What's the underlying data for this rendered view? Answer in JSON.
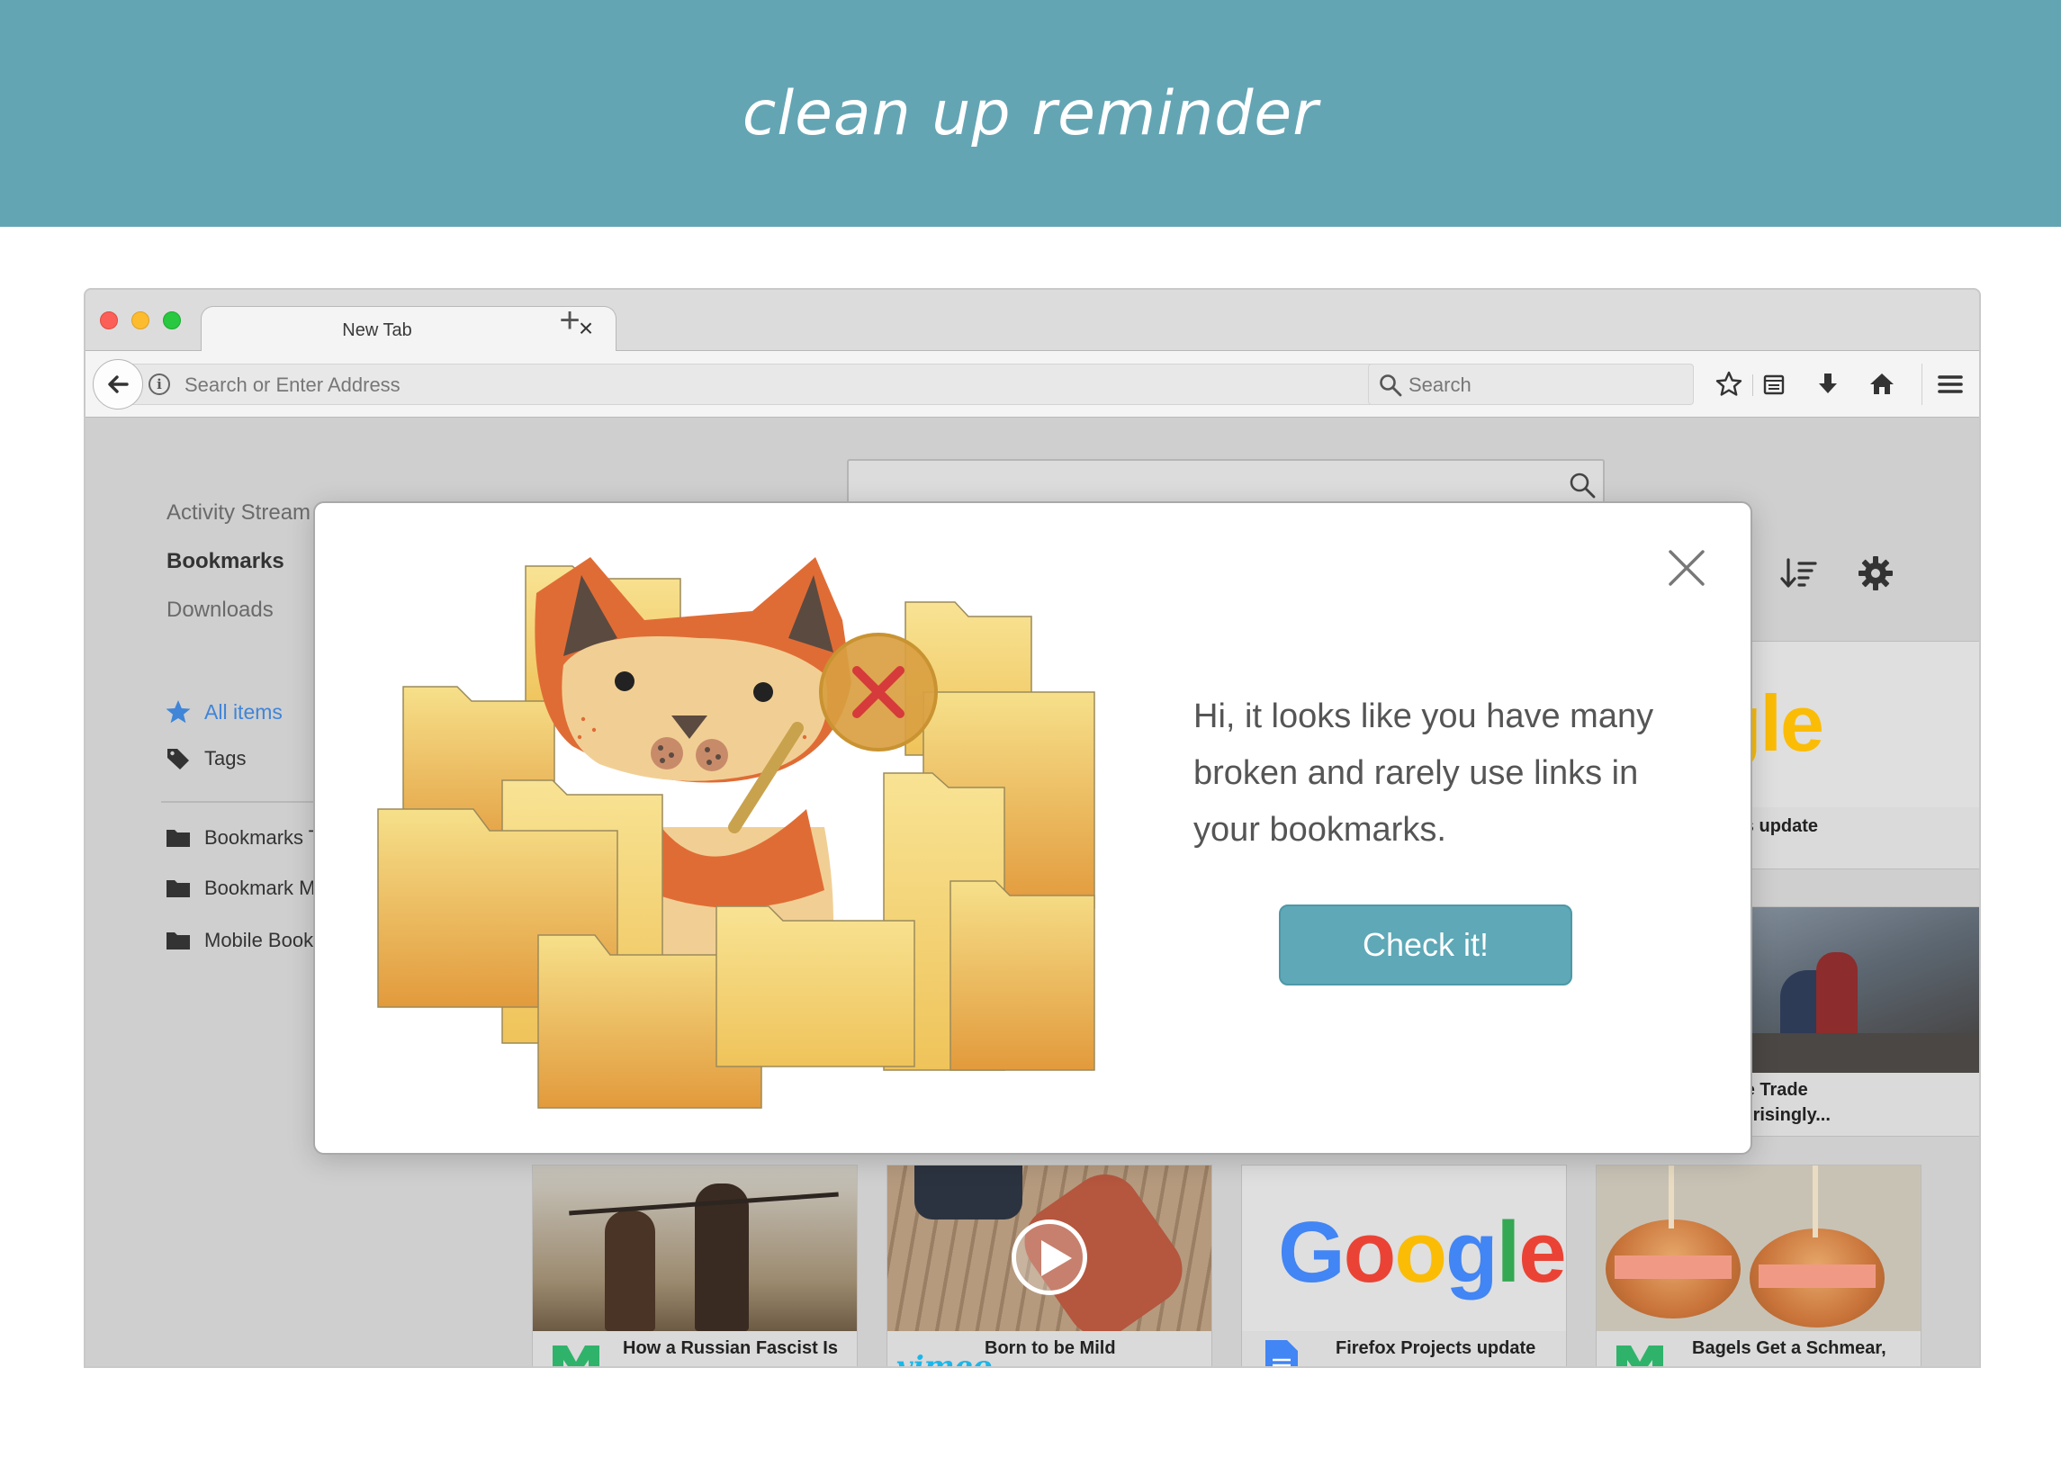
{
  "banner": {
    "title": "clean up reminder"
  },
  "tab": {
    "label": "New Tab",
    "close_glyph": "×",
    "new_tab_glyph": "+"
  },
  "toolbar": {
    "address_placeholder": "Search or Enter Address",
    "search_placeholder": "Search"
  },
  "sidebar": {
    "top_items": [
      "Activity Stream",
      "Bookmarks",
      "Downloads"
    ],
    "items": [
      {
        "label": "All items",
        "icon": "star-icon",
        "active": true
      },
      {
        "label": "Tags",
        "icon": "tag-icon",
        "active": false
      }
    ],
    "folders": [
      {
        "label": "Bookmarks T",
        "icon": "folder-icon"
      },
      {
        "label": "Bookmark M",
        "icon": "folder-icon"
      },
      {
        "label": "Mobile Book",
        "icon": "folder-icon"
      }
    ]
  },
  "cards": {
    "right": [
      {
        "brand": "ogle",
        "title": "Projects update"
      },
      {
        "line1": "ates Free Trade",
        "line2": "es? Surprisingly..."
      }
    ],
    "bottom": [
      {
        "title": "How a Russian Fascist Is",
        "source_icon": "medium-icon"
      },
      {
        "title": "Born to be Mild",
        "source_label": "vimeo",
        "source_icon": "vimeo-icon"
      },
      {
        "title": "Firefox Projects update",
        "brand": "Google",
        "source_icon": "google-docs-icon"
      },
      {
        "title": "Bagels Get a Schmear,",
        "source_icon": "medium-icon"
      }
    ]
  },
  "modal": {
    "message": "Hi, it looks like you have many broken and rarely use links in your bookmarks.",
    "button_label": "Check it!",
    "illustration": "fox-with-folders-and-magnifier"
  },
  "colors": {
    "banner": "#64a5b4",
    "button": "#5ea8b7",
    "link_blue": "#3f85d8",
    "fox_orange": "#e06c35",
    "folder_yellow": "#f5d26a",
    "error_red": "#d63a3a"
  }
}
